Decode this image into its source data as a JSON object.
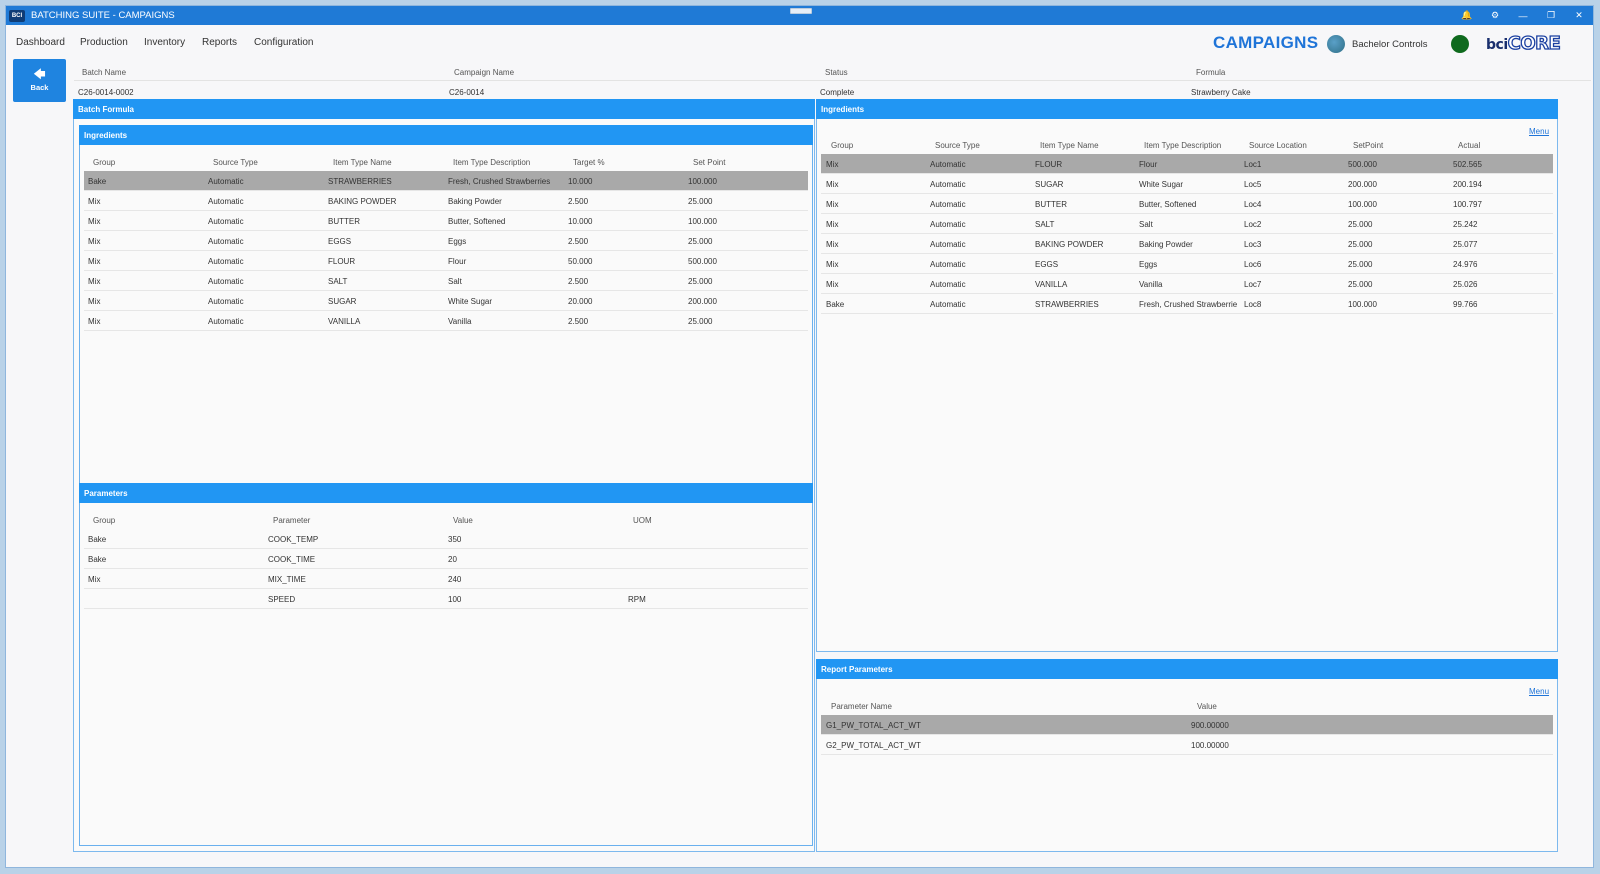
{
  "window": {
    "title": "BATCHING SUITE - CAMPAIGNS",
    "logo": "BCI"
  },
  "nav": {
    "items": [
      {
        "label": "Dashboard"
      },
      {
        "label": "Production"
      },
      {
        "label": "Inventory"
      },
      {
        "label": "Reports"
      },
      {
        "label": "Configuration"
      }
    ]
  },
  "header": {
    "page_title": "CAMPAIGNS",
    "organization": "Bachelor Controls",
    "logo_prefix": "bci",
    "logo_main": "CORE",
    "status_color": "#0f6a1e"
  },
  "back": {
    "label": "Back"
  },
  "summary": {
    "headers": [
      "Batch Name",
      "Campaign Name",
      "Status",
      "Formula"
    ],
    "values": [
      "C26-0014-0002",
      "C26-0014",
      "Complete",
      "Strawberry Cake"
    ]
  },
  "batch_formula": {
    "title": "Batch Formula",
    "ingredients": {
      "title": "Ingredients",
      "columns": [
        "Group",
        "Source Type",
        "Item Type Name",
        "Item Type Description",
        "Target %",
        "Set Point"
      ],
      "rows": [
        [
          "Bake",
          "Automatic",
          "STRAWBERRIES",
          "Fresh, Crushed Strawberries",
          "10.000",
          "100.000"
        ],
        [
          "Mix",
          "Automatic",
          "BAKING POWDER",
          "Baking Powder",
          "2.500",
          "25.000"
        ],
        [
          "Mix",
          "Automatic",
          "BUTTER",
          "Butter, Softened",
          "10.000",
          "100.000"
        ],
        [
          "Mix",
          "Automatic",
          "EGGS",
          "Eggs",
          "2.500",
          "25.000"
        ],
        [
          "Mix",
          "Automatic",
          "FLOUR",
          "Flour",
          "50.000",
          "500.000"
        ],
        [
          "Mix",
          "Automatic",
          "SALT",
          "Salt",
          "2.500",
          "25.000"
        ],
        [
          "Mix",
          "Automatic",
          "SUGAR",
          "White Sugar",
          "20.000",
          "200.000"
        ],
        [
          "Mix",
          "Automatic",
          "VANILLA",
          "Vanilla",
          "2.500",
          "25.000"
        ]
      ]
    },
    "parameters": {
      "title": "Parameters",
      "columns": [
        "Group",
        "Parameter",
        "Value",
        "UOM"
      ],
      "rows": [
        [
          "Bake",
          "COOK_TEMP",
          "350",
          ""
        ],
        [
          "Bake",
          "COOK_TIME",
          "20",
          ""
        ],
        [
          "Mix",
          "MIX_TIME",
          "240",
          ""
        ],
        [
          "",
          "SPEED",
          "100",
          "RPM"
        ]
      ]
    }
  },
  "ingredients_actual": {
    "title": "Ingredients",
    "menu_label": "Menu",
    "columns": [
      "Group",
      "Source Type",
      "Item Type Name",
      "Item Type Description",
      "Source Location",
      "SetPoint",
      "Actual"
    ],
    "rows": [
      [
        "Mix",
        "Automatic",
        "FLOUR",
        "Flour",
        "Loc1",
        "500.000",
        "502.565"
      ],
      [
        "Mix",
        "Automatic",
        "SUGAR",
        "White Sugar",
        "Loc5",
        "200.000",
        "200.194"
      ],
      [
        "Mix",
        "Automatic",
        "BUTTER",
        "Butter, Softened",
        "Loc4",
        "100.000",
        "100.797"
      ],
      [
        "Mix",
        "Automatic",
        "SALT",
        "Salt",
        "Loc2",
        "25.000",
        "25.242"
      ],
      [
        "Mix",
        "Automatic",
        "BAKING POWDER",
        "Baking Powder",
        "Loc3",
        "25.000",
        "25.077"
      ],
      [
        "Mix",
        "Automatic",
        "EGGS",
        "Eggs",
        "Loc6",
        "25.000",
        "24.976"
      ],
      [
        "Mix",
        "Automatic",
        "VANILLA",
        "Vanilla",
        "Loc7",
        "25.000",
        "25.026"
      ],
      [
        "Bake",
        "Automatic",
        "STRAWBERRIES",
        "Fresh, Crushed Strawberrie",
        "Loc8",
        "100.000",
        "99.766"
      ]
    ]
  },
  "report_parameters": {
    "title": "Report Parameters",
    "menu_label": "Menu",
    "columns": [
      "Parameter Name",
      "Value"
    ],
    "rows": [
      [
        "G1_PW_TOTAL_ACT_WT",
        "900.00000"
      ],
      [
        "G2_PW_TOTAL_ACT_WT",
        "100.00000"
      ]
    ]
  },
  "window_controls": [
    "bell-icon",
    "gear-icon",
    "minimize-icon",
    "restore-icon",
    "close-icon"
  ]
}
